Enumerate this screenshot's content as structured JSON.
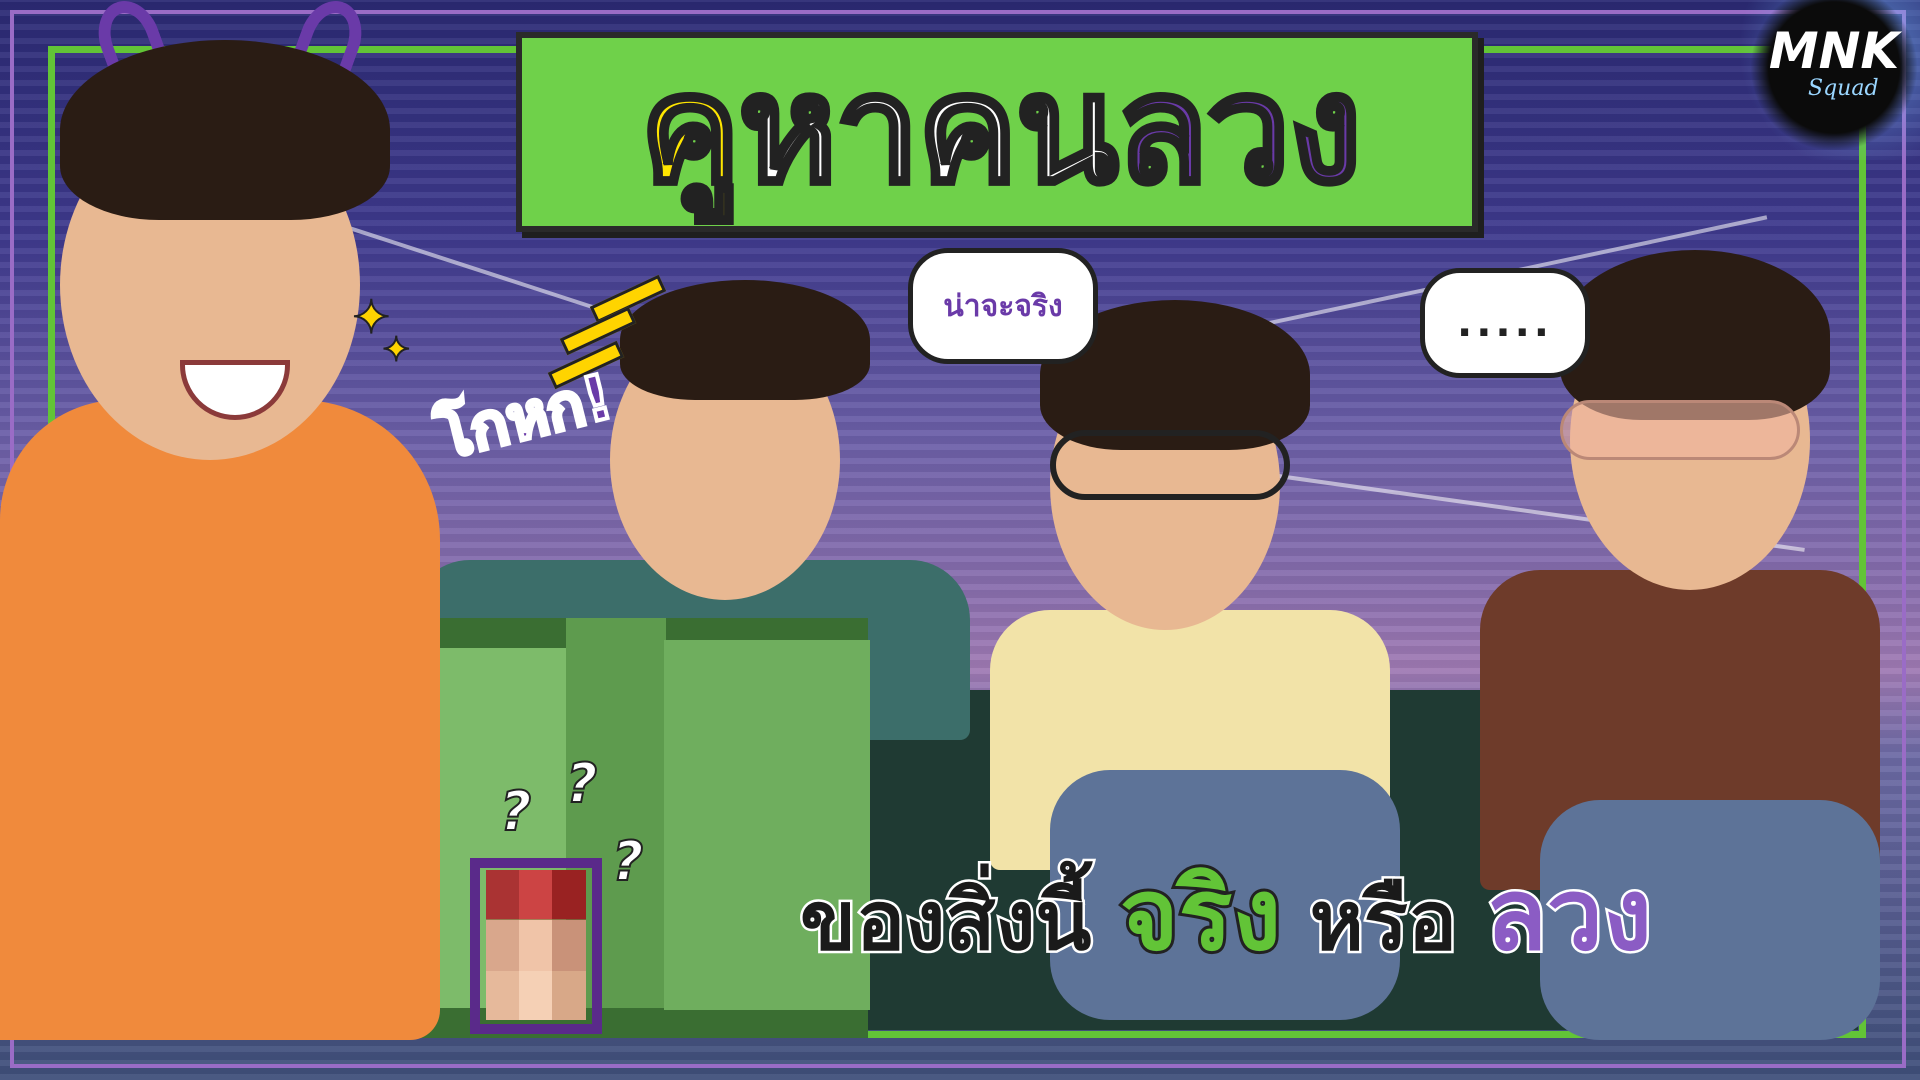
{
  "thumbnail": {
    "title": {
      "part1": "คู",
      "part2": "หาคน",
      "part3": "ลวง"
    },
    "logo": {
      "brand": "MNK",
      "sub": "Squad"
    },
    "bubbles": {
      "left": "น่าจะจริง",
      "right": "....."
    },
    "exclamation": "โกหก!",
    "question_marks": [
      "?",
      "?",
      "?"
    ],
    "caption": {
      "part1": "ของสิ่งนี้ ",
      "part2": "จริง",
      "part3": " หรือ ",
      "part4": "ลวง"
    },
    "colors": {
      "green": "#62c437",
      "purple": "#6a3aa8",
      "yellow": "#ffe600",
      "orange_shirt": "#f08a3c"
    }
  }
}
